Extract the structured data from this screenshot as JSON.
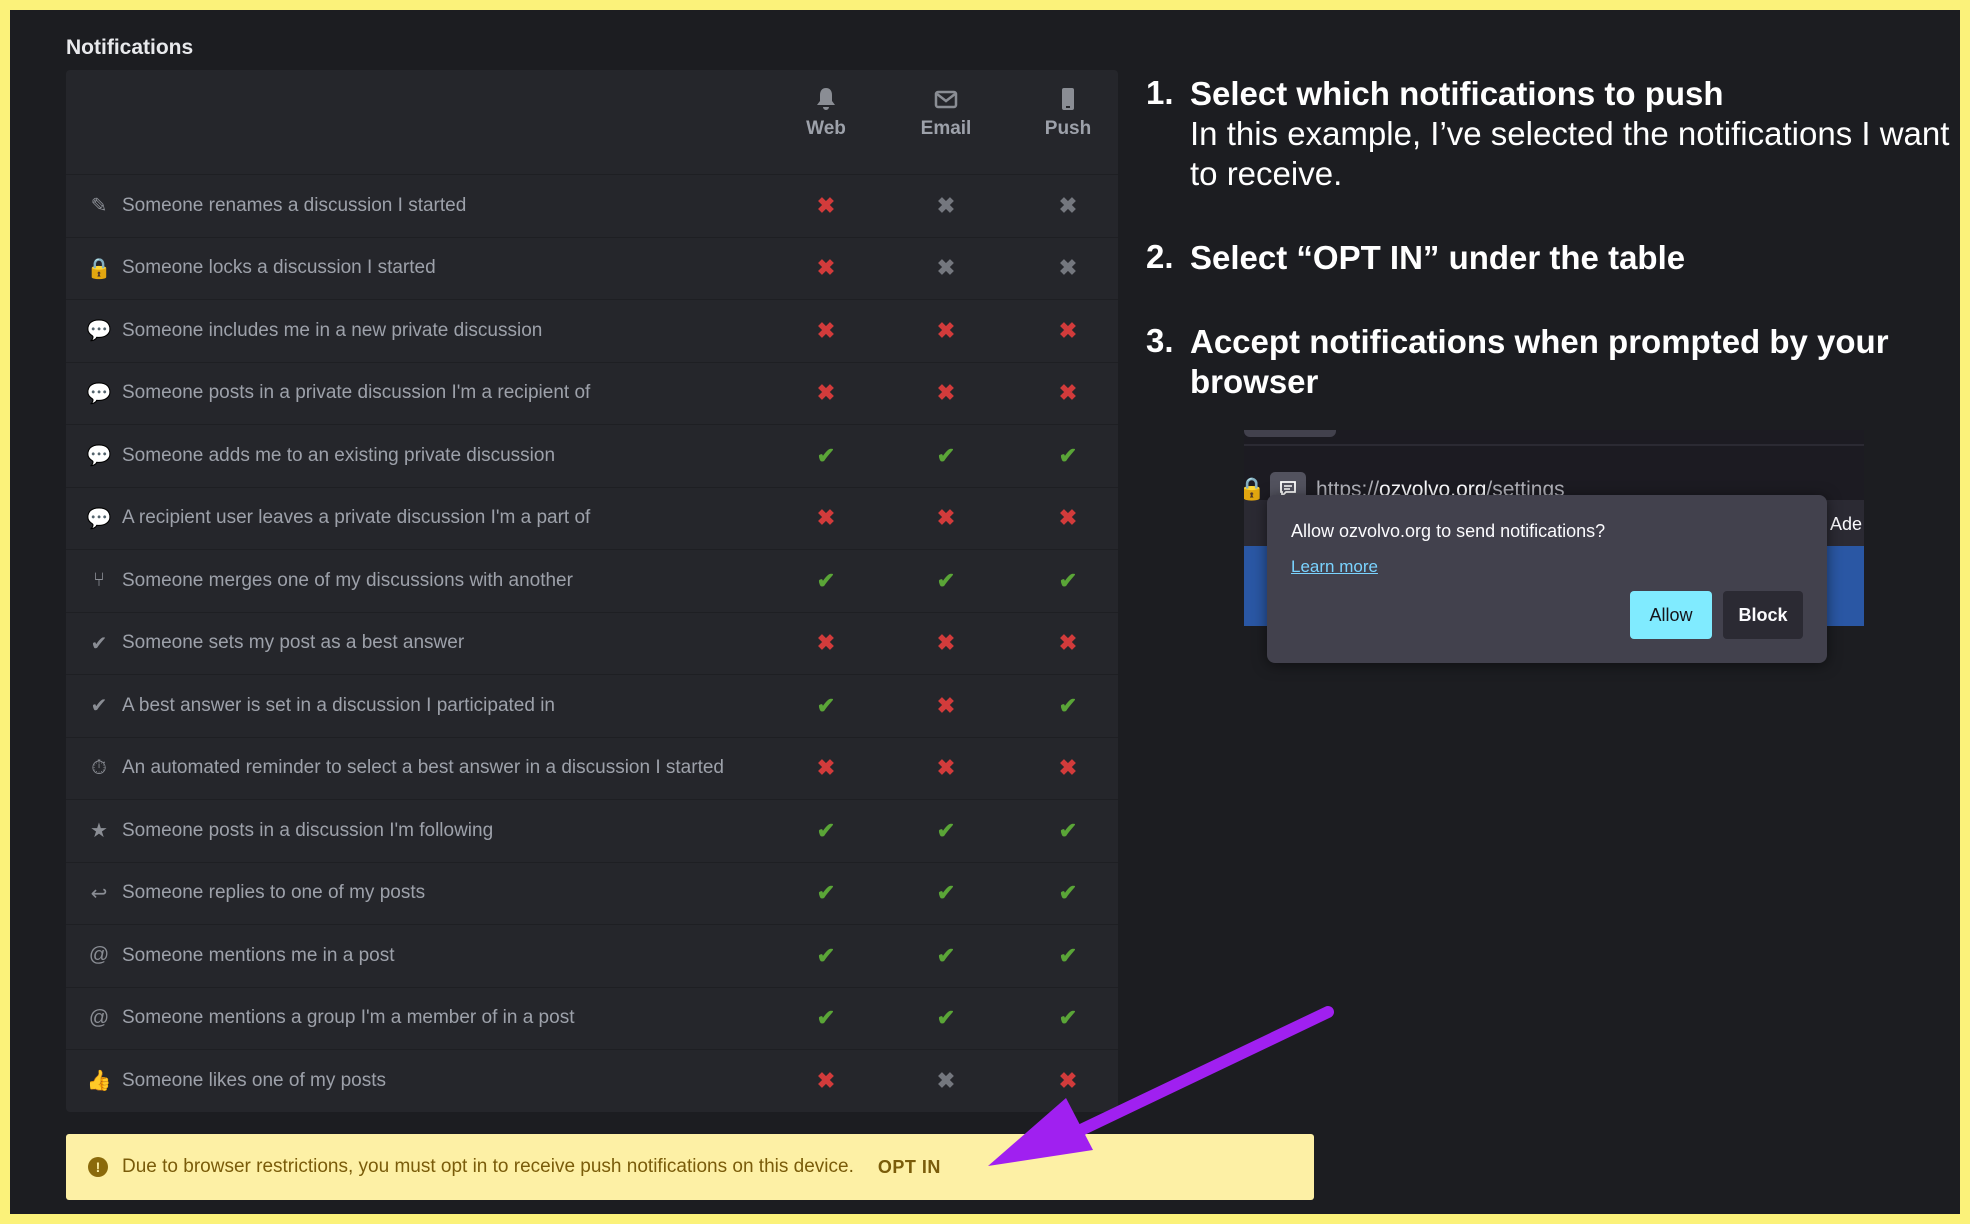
{
  "section_title": "Notifications",
  "columns": {
    "web": "Web",
    "email": "Email",
    "push": "Push"
  },
  "rows": [
    {
      "icon": "pencil-icon",
      "glyph": "✎",
      "label": "Someone renames a discussion I started",
      "web": "off-red",
      "email": "off-grey",
      "push": "off-grey"
    },
    {
      "icon": "lock-icon",
      "glyph": "🔒",
      "label": "Someone locks a discussion I started",
      "web": "off-red",
      "email": "off-grey",
      "push": "off-grey"
    },
    {
      "icon": "comments-icon",
      "glyph": "💬",
      "label": "Someone includes me in a new private discussion",
      "web": "off-red",
      "email": "off-red",
      "push": "off-red"
    },
    {
      "icon": "comments-icon",
      "glyph": "💬",
      "label": "Someone posts in a private discussion I'm a recipient of",
      "web": "off-red",
      "email": "off-red",
      "push": "off-red"
    },
    {
      "icon": "comments-icon",
      "glyph": "💬",
      "label": "Someone adds me to an existing private discussion",
      "web": "on",
      "email": "on",
      "push": "on"
    },
    {
      "icon": "comments-icon",
      "glyph": "💬",
      "label": "A recipient user leaves a private discussion I'm a part of",
      "web": "off-red",
      "email": "off-red",
      "push": "off-red"
    },
    {
      "icon": "merge-icon",
      "glyph": "⑂",
      "label": "Someone merges one of my discussions with another",
      "web": "on",
      "email": "on",
      "push": "on"
    },
    {
      "icon": "check-icon",
      "glyph": "✔",
      "label": "Someone sets my post as a best answer",
      "web": "off-red",
      "email": "off-red",
      "push": "off-red"
    },
    {
      "icon": "check-icon",
      "glyph": "✔",
      "label": "A best answer is set in a discussion I participated in",
      "web": "on",
      "email": "off-red",
      "push": "on"
    },
    {
      "icon": "stopwatch-icon",
      "glyph": "⏱",
      "label": "An automated reminder to select a best answer in a discussion I started",
      "web": "off-red",
      "email": "off-red",
      "push": "off-red"
    },
    {
      "icon": "star-icon",
      "glyph": "★",
      "label": "Someone posts in a discussion I'm following",
      "web": "on",
      "email": "on",
      "push": "on"
    },
    {
      "icon": "reply-icon",
      "glyph": "↩",
      "label": "Someone replies to one of my posts",
      "web": "on",
      "email": "on",
      "push": "on"
    },
    {
      "icon": "at-icon",
      "glyph": "@",
      "label": "Someone mentions me in a post",
      "web": "on",
      "email": "on",
      "push": "on"
    },
    {
      "icon": "at-icon",
      "glyph": "@",
      "label": "Someone mentions a group I'm a member of in a post",
      "web": "on",
      "email": "on",
      "push": "on"
    },
    {
      "icon": "thumbs-up-icon",
      "glyph": "👍",
      "label": "Someone likes one of my posts",
      "web": "off-red",
      "email": "off-grey",
      "push": "off-red"
    }
  ],
  "banner": {
    "message": "Due to browser restrictions, you must opt in to receive push notifications on this device.",
    "opt_in": "OPT IN"
  },
  "steps": [
    {
      "num": "1.",
      "head": "Select which notifications to push",
      "body": "In this example, I’ve selected the notifications I want to receive."
    },
    {
      "num": "2.",
      "head": "Select “OPT IN” under the table",
      "body": ""
    },
    {
      "num": "3.",
      "head": "Accept notifications when prompted by your browser",
      "body": ""
    }
  ],
  "browser": {
    "url_prefix": "https://",
    "url_host": "ozvolvo.org",
    "url_path": "/settings",
    "ade": "Ade",
    "question": "Allow ozvolvo.org to send notifications?",
    "learn_more": "Learn more",
    "allow": "Allow",
    "block": "Block"
  },
  "colors": {
    "frame": "#fbf27a",
    "background": "#1c1d21",
    "check": "#5aa537",
    "cross_red": "#d23b3b",
    "cross_grey": "#74777e",
    "arrow": "#a020f0",
    "allow_button": "#80ebff"
  }
}
